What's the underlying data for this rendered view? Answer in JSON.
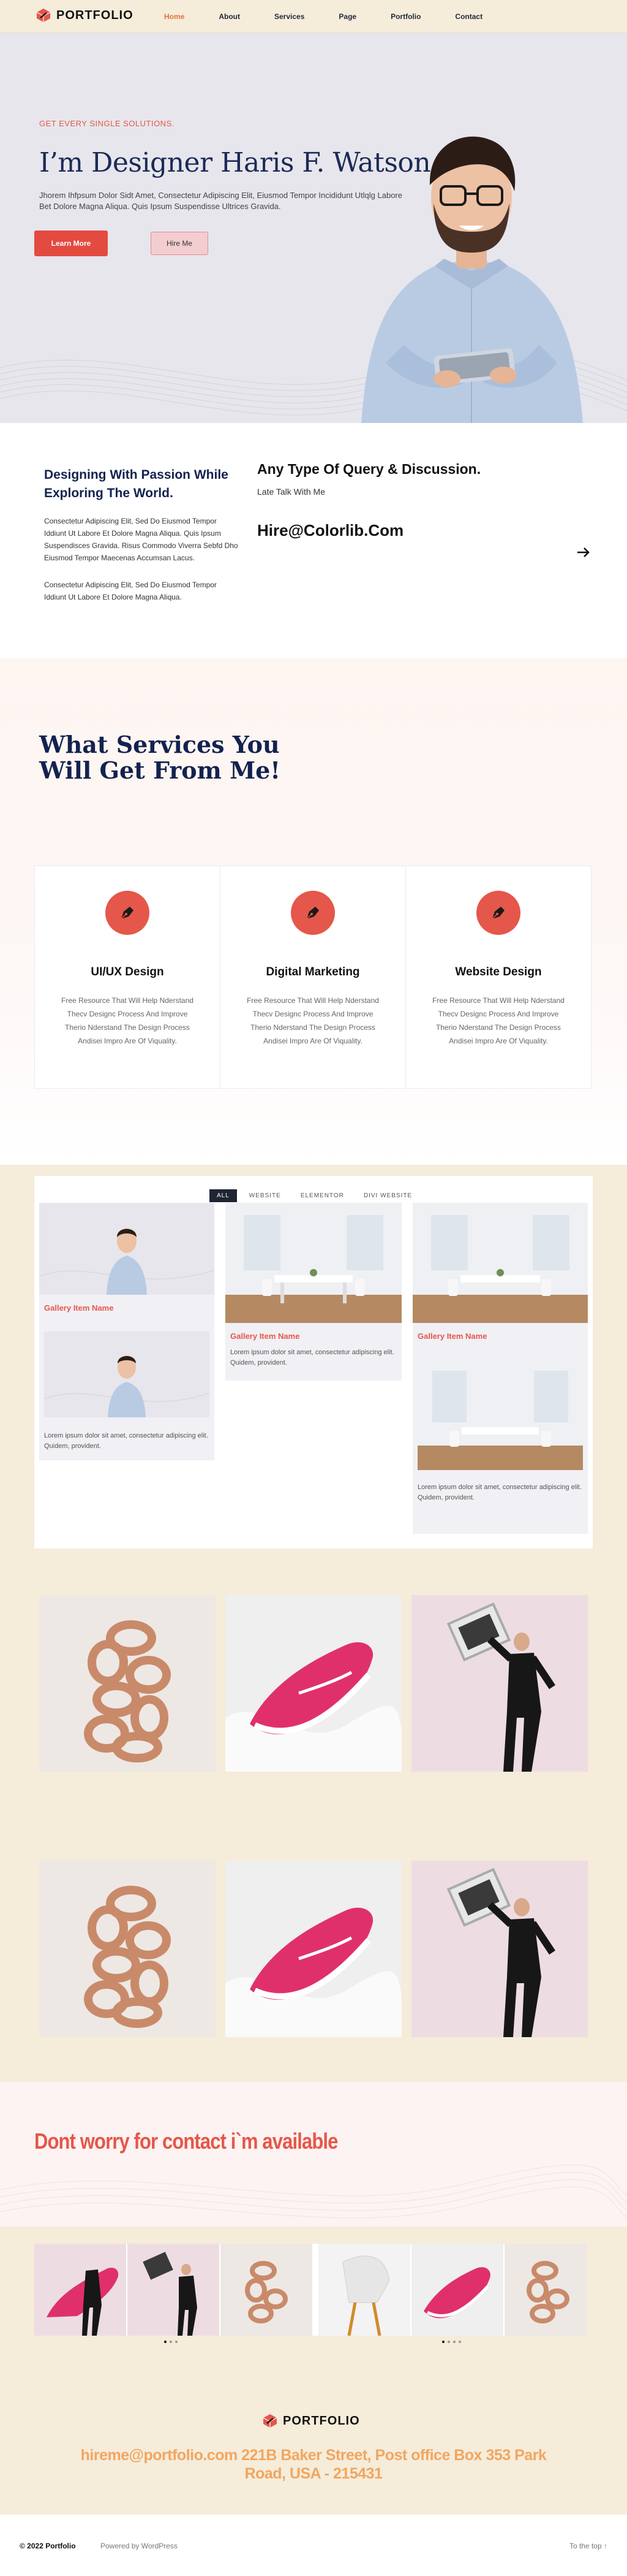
{
  "header": {
    "logo_text": "PORTFOLIO",
    "nav": [
      "Home",
      "About",
      "Services",
      "Page",
      "Portfolio",
      "Contact"
    ],
    "active_nav": "Home"
  },
  "hero": {
    "eyebrow": "GET EVERY SINGLE SOLUTIONS.",
    "title": "I’m Designer Haris F. Watson",
    "text": "Jhorem Ihfpsum Dolor Sidt Amet, Consectetur Adipiscing Elit, Eiusmod Tempor Incididunt Utlqlg Labore Bet Dolore Magna Aliqua. Quis Ipsum Suspendisse Ultrices Gravida.",
    "primary_button": "Learn More",
    "secondary_button": "Hire Me"
  },
  "about": {
    "heading": "Designing With Passion While Exploring The World.",
    "para1": "Consectetur Adipiscing Elit, Sed Do Eiusmod Tempor Iddiunt Ut Labore Et Dolore Magna Aliqua. Quis Ipsum Suspendisces Gravida. Risus Commodo Viverra Sebfd Dho Eiusmod Tempor Maecenas Accumsan Lacus.",
    "para2": "Consectetur Adipiscing Elit, Sed Do Eiusmod Tempor Iddiunt Ut Labore Et Dolore Magna Aliqua.",
    "query_heading": "Any Type Of Query & Discussion.",
    "query_sub": "Late Talk With Me",
    "email": "Hire@Colorlib.Com"
  },
  "services": {
    "heading": "What Services You Will Get From Me!",
    "items": [
      {
        "title": "UI/UX Design",
        "text": "Free Resource That Will Help Nderstand Thecv Designc Process And Improve Therio Nderstand The Design Process Andisei Impro Are Of Viquality."
      },
      {
        "title": "Digital Marketing",
        "text": "Free Resource That Will Help Nderstand Thecv Designc Process And Improve Therio Nderstand The Design Process Andisei Impro Are Of Viquality."
      },
      {
        "title": "Website Design",
        "text": "Free Resource That Will Help Nderstand Thecv Designc Process And Improve Therio Nderstand The Design Process Andisei Impro Are Of Viquality."
      }
    ],
    "accent_color": "#e5574a"
  },
  "gallery": {
    "filters": [
      "ALL",
      "WEBSITE",
      "ELEMENTOR",
      "DIVI WEBSITE"
    ],
    "active_filter": "ALL",
    "item_name": "Gallery Item Name",
    "item_desc": "Lorem ipsum dolor sit amet, consectetur adipiscing elit. Quidem, provident."
  },
  "contact": {
    "heading": "Dont worry for contact i`m available"
  },
  "footer": {
    "logo_text": "PORTFOLIO",
    "contact_line": "hireme@portfolio.com 221B Baker Street, Post office Box 353 Park Road, USA - 215431",
    "copyright": "© 2022 Portfolio",
    "powered": "Powered by WordPress",
    "to_top": "To the top ↑"
  },
  "colors": {
    "accent": "#e5574a",
    "navy": "#13224f",
    "cream": "#f5ecda",
    "orange": "#f2a65f"
  }
}
